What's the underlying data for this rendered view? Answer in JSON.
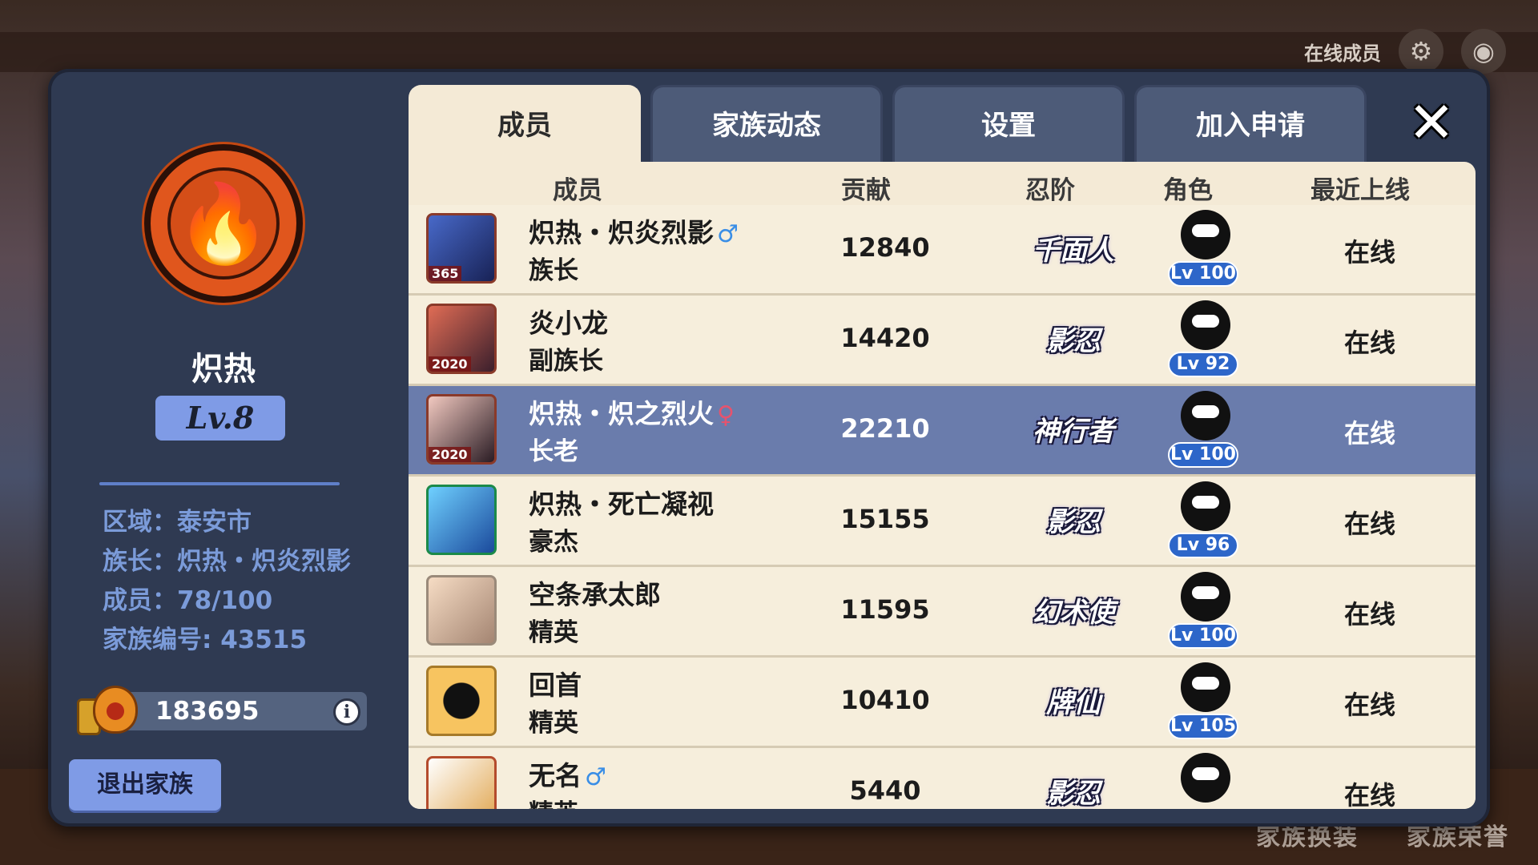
{
  "hud": {
    "online_label": "在线成员",
    "bottom_left": "家族换装",
    "bottom_right": "家族荣誉"
  },
  "clan": {
    "name": "炽热",
    "level": "Lv.8",
    "region": "区域：泰安市",
    "leader": "族长：炽热・炽炎烈影",
    "members": "成员：78/100",
    "id": "家族编号: 43515",
    "funds": "183695",
    "leave_label": "退出家族",
    "info_symbol": "i"
  },
  "tabs": [
    {
      "label": "成员",
      "active": true
    },
    {
      "label": "家族动态",
      "active": false
    },
    {
      "label": "设置",
      "active": false
    },
    {
      "label": "加入申请",
      "active": false
    }
  ],
  "close_symbol": "✕",
  "columns": {
    "member": "成员",
    "contribution": "贡献",
    "rank": "忍阶",
    "character": "角色",
    "last_online": "最近上线"
  },
  "rows": [
    {
      "name": "炽热・炽炎烈影",
      "gender": "♂",
      "role": "族长",
      "contribution": "12840",
      "rank": "千面人",
      "level": "Lv 100",
      "online": "在线",
      "avatar_tag": "365"
    },
    {
      "name": "炎小龙",
      "gender": "",
      "role": "副族长",
      "contribution": "14420",
      "rank": "影忍",
      "level": "Lv 92",
      "online": "在线",
      "avatar_tag": "2020"
    },
    {
      "name": "炽热・炽之烈火",
      "gender": "♀",
      "role": "长老",
      "contribution": "22210",
      "rank": "神行者",
      "level": "Lv 100",
      "online": "在线",
      "avatar_tag": "2020"
    },
    {
      "name": "炽热・死亡凝视",
      "gender": "",
      "role": "豪杰",
      "contribution": "15155",
      "rank": "影忍",
      "level": "Lv 96",
      "online": "在线",
      "avatar_tag": ""
    },
    {
      "name": "空条承太郎",
      "gender": "",
      "role": "精英",
      "contribution": "11595",
      "rank": "幻术使",
      "level": "Lv 100",
      "online": "在线",
      "avatar_tag": ""
    },
    {
      "name": "回首",
      "gender": "",
      "role": "精英",
      "contribution": "10410",
      "rank": "牌仙",
      "level": "Lv 105",
      "online": "在线",
      "avatar_tag": ""
    },
    {
      "name": "无名",
      "gender": "♂",
      "role": "精英",
      "contribution": "5440",
      "rank": "影忍",
      "level": "",
      "online": "在线",
      "avatar_tag": ""
    }
  ],
  "colors": {
    "panel": "#2f3a52",
    "tab_active": "#f4ead6",
    "tab_inactive": "#4d5b78",
    "accent_blue": "#7f9be6",
    "selected_row": "#6a7cac",
    "emblem": "#e0561d"
  }
}
